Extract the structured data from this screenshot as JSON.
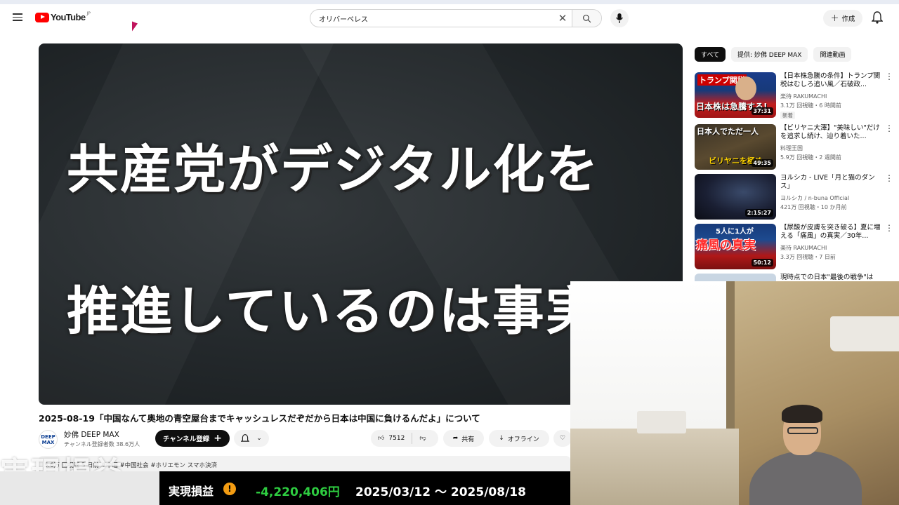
{
  "header": {
    "logo_text": "YouTube",
    "logo_region": "JP",
    "search_value": "オリバーペレス",
    "create_label": "作成"
  },
  "video": {
    "thumbnail_line1": "共産党がデジタル化を",
    "thumbnail_line2": "推進しているのは事実",
    "title": "2025-08-19「中国なんて奥地の青空屋台までキャッシュレスだぞだから日本は中国に負けるんだよ」について",
    "channel_avatar": "DEEP MAX",
    "channel_name": "妙佛 DEEP MAX",
    "channel_subs": "チャンネル登録者数 38.6万人",
    "subscribe_label": "チャンネル登録",
    "like_count": "7512",
    "share_label": "共有",
    "offline_label": "オフライン",
    "description": "5.6万 回視聴  5 日前  #中国  #中国社会  #ホリエモン  スマホ決済",
    "overlay_text": "実現損益"
  },
  "banner": {
    "label": "実現損益",
    "warn": "!",
    "value": "-4,220,406円",
    "range": "2025/03/12 ～ 2025/08/18"
  },
  "sidebar": {
    "chips": [
      "すべて",
      "提供: 妙佛 DEEP MAX",
      "関連動画"
    ],
    "items": [
      {
        "title": "【日本株急騰の条件】トランプ関税はむしろ追い風／石破政...",
        "channel": "楽待 RAKUMACHI",
        "meta": "3.1万 回視聴・6 時間前",
        "badge": "新着",
        "duration": "37:31",
        "thumb_text_a": "トランプ関税",
        "thumb_text_b": "日本株は急騰する!"
      },
      {
        "title": "【ビリヤニ大澤】\"美味しい\"だけを追求し続け、辿り着いた...",
        "channel": "料理王国",
        "meta": "5.9万 回視聴・2 週間前",
        "duration": "49:35",
        "thumb_text_a": "日本人でただ一人",
        "thumb_text_b": "ビリヤニを極め"
      },
      {
        "title": "ヨルシカ - LIVE「月と猫のダンス」",
        "channel": "ヨルシカ / n-buna Official",
        "meta": "421万 回視聴・10 か月前",
        "duration": "2:15:27"
      },
      {
        "title": "【尿酸が皮膚を突き破る】夏に増える「痛風」の真実／30年...",
        "channel": "楽待 RAKUMACHI",
        "meta": "3.3万 回視聴・7 日前",
        "duration": "50:12",
        "thumb_text_a": "5人に1人が",
        "thumb_text_b": "痛風の真実"
      },
      {
        "title": "現時点での日本\"最後の戦争\"は"
      }
    ]
  }
}
